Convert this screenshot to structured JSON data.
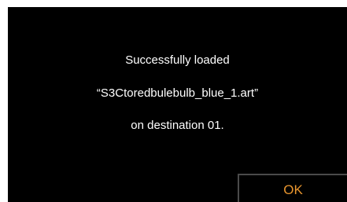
{
  "dialog": {
    "message_line_1": "Successfully loaded",
    "message_line_2": "“S3Ctoredbulebulb_blue_1.art”",
    "message_line_3": "on destination 01.",
    "ok_label": "OK"
  },
  "colors": {
    "background": "#000000",
    "text": "#ffffff",
    "accent": "#e8952e",
    "button_border": "#4a4a4a"
  }
}
